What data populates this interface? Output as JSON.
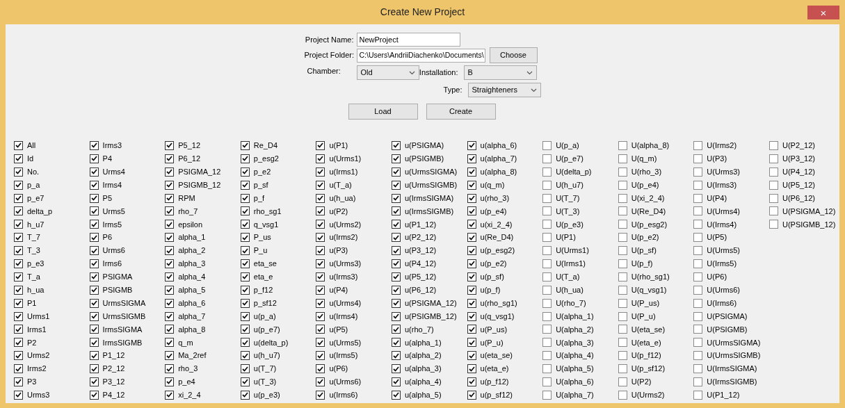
{
  "window": {
    "title": "Create New Project",
    "close": "×"
  },
  "form": {
    "project_name": {
      "label": "Project Name:",
      "value": "NewProject"
    },
    "project_folder": {
      "label": "Project Folder:",
      "value": "C:\\Users\\AndriiDiachenko\\Documents\\",
      "button": "Choose"
    },
    "chamber": {
      "label": "Chamber:",
      "value": "Old"
    },
    "installation": {
      "label": "Installation:",
      "value": "B"
    },
    "type": {
      "label": "Type:",
      "value": "Straighteners"
    },
    "buttons": [
      "Load",
      "Create"
    ]
  },
  "checkboxes": [
    {
      "label": "All",
      "checked": true
    },
    {
      "label": "Id",
      "checked": true
    },
    {
      "label": "No.",
      "checked": true
    },
    {
      "label": "p_a",
      "checked": true
    },
    {
      "label": "p_e7",
      "checked": true
    },
    {
      "label": "delta_p",
      "checked": true
    },
    {
      "label": "h_u7",
      "checked": true
    },
    {
      "label": "T_7",
      "checked": true
    },
    {
      "label": "T_3",
      "checked": true
    },
    {
      "label": "p_e3",
      "checked": true
    },
    {
      "label": "T_a",
      "checked": true
    },
    {
      "label": "h_ua",
      "checked": true
    },
    {
      "label": "P1",
      "checked": true
    },
    {
      "label": "Urms1",
      "checked": true
    },
    {
      "label": "Irms1",
      "checked": true
    },
    {
      "label": "P2",
      "checked": true
    },
    {
      "label": "Urms2",
      "checked": true
    },
    {
      "label": "Irms2",
      "checked": true
    },
    {
      "label": "P3",
      "checked": true
    },
    {
      "label": "Urms3",
      "checked": true
    },
    {
      "label": "Irms3",
      "checked": true
    },
    {
      "label": "P4",
      "checked": true
    },
    {
      "label": "Urms4",
      "checked": true
    },
    {
      "label": "Irms4",
      "checked": true
    },
    {
      "label": "P5",
      "checked": true
    },
    {
      "label": "Urms5",
      "checked": true
    },
    {
      "label": "Irms5",
      "checked": true
    },
    {
      "label": "P6",
      "checked": true
    },
    {
      "label": "Urms6",
      "checked": true
    },
    {
      "label": "Irms6",
      "checked": true
    },
    {
      "label": "PSIGMA",
      "checked": true
    },
    {
      "label": "PSIGMB",
      "checked": true
    },
    {
      "label": "UrmsSIGMA",
      "checked": true
    },
    {
      "label": "UrmsSIGMB",
      "checked": true
    },
    {
      "label": "IrmsSIGMA",
      "checked": true
    },
    {
      "label": "IrmsSIGMB",
      "checked": true
    },
    {
      "label": "P1_12",
      "checked": true
    },
    {
      "label": "P2_12",
      "checked": true
    },
    {
      "label": "P3_12",
      "checked": true
    },
    {
      "label": "P4_12",
      "checked": true
    },
    {
      "label": "P5_12",
      "checked": true
    },
    {
      "label": "P6_12",
      "checked": true
    },
    {
      "label": "PSIGMA_12",
      "checked": true
    },
    {
      "label": "PSIGMB_12",
      "checked": true
    },
    {
      "label": "RPM",
      "checked": true
    },
    {
      "label": "rho_7",
      "checked": true
    },
    {
      "label": "epsilon",
      "checked": true
    },
    {
      "label": "alpha_1",
      "checked": true
    },
    {
      "label": "alpha_2",
      "checked": true
    },
    {
      "label": "alpha_3",
      "checked": true
    },
    {
      "label": "alpha_4",
      "checked": true
    },
    {
      "label": "alpha_5",
      "checked": true
    },
    {
      "label": "alpha_6",
      "checked": true
    },
    {
      "label": "alpha_7",
      "checked": true
    },
    {
      "label": "alpha_8",
      "checked": true
    },
    {
      "label": "q_m",
      "checked": true
    },
    {
      "label": "Ma_2ref",
      "checked": true
    },
    {
      "label": "rho_3",
      "checked": true
    },
    {
      "label": "p_e4",
      "checked": true
    },
    {
      "label": "xi_2_4",
      "checked": true
    },
    {
      "label": "Re_D4",
      "checked": true
    },
    {
      "label": "p_esg2",
      "checked": true
    },
    {
      "label": "p_e2",
      "checked": true
    },
    {
      "label": "p_sf",
      "checked": true
    },
    {
      "label": "p_f",
      "checked": true
    },
    {
      "label": "rho_sg1",
      "checked": true
    },
    {
      "label": "q_vsg1",
      "checked": true
    },
    {
      "label": "P_us",
      "checked": true
    },
    {
      "label": "P_u",
      "checked": true
    },
    {
      "label": "eta_se",
      "checked": true
    },
    {
      "label": "eta_e",
      "checked": true
    },
    {
      "label": "p_f12",
      "checked": true
    },
    {
      "label": "p_sf12",
      "checked": true
    },
    {
      "label": "u(p_a)",
      "checked": true
    },
    {
      "label": "u(p_e7)",
      "checked": true
    },
    {
      "label": "u(delta_p)",
      "checked": true
    },
    {
      "label": "u(h_u7)",
      "checked": true
    },
    {
      "label": "u(T_7)",
      "checked": true
    },
    {
      "label": "u(T_3)",
      "checked": true
    },
    {
      "label": "u(p_e3)",
      "checked": true
    },
    {
      "label": "u(P1)",
      "checked": true
    },
    {
      "label": "u(Urms1)",
      "checked": true
    },
    {
      "label": "u(Irms1)",
      "checked": true
    },
    {
      "label": "u(T_a)",
      "checked": true
    },
    {
      "label": "u(h_ua)",
      "checked": true
    },
    {
      "label": "u(P2)",
      "checked": true
    },
    {
      "label": "u(Urms2)",
      "checked": true
    },
    {
      "label": "u(Irms2)",
      "checked": true
    },
    {
      "label": "u(P3)",
      "checked": true
    },
    {
      "label": "u(Urms3)",
      "checked": true
    },
    {
      "label": "u(Irms3)",
      "checked": true
    },
    {
      "label": "u(P4)",
      "checked": true
    },
    {
      "label": "u(Urms4)",
      "checked": true
    },
    {
      "label": "u(Irms4)",
      "checked": true
    },
    {
      "label": "u(P5)",
      "checked": true
    },
    {
      "label": "u(Urms5)",
      "checked": true
    },
    {
      "label": "u(Irms5)",
      "checked": true
    },
    {
      "label": "u(P6)",
      "checked": true
    },
    {
      "label": "u(Urms6)",
      "checked": true
    },
    {
      "label": "u(Irms6)",
      "checked": true
    },
    {
      "label": "u(PSIGMA)",
      "checked": true
    },
    {
      "label": "u(PSIGMB)",
      "checked": true
    },
    {
      "label": "u(UrmsSIGMA)",
      "checked": true
    },
    {
      "label": "u(UrmsSIGMB)",
      "checked": true
    },
    {
      "label": "u(IrmsSIGMA)",
      "checked": true
    },
    {
      "label": "u(IrmsSIGMB)",
      "checked": true
    },
    {
      "label": "u(P1_12)",
      "checked": true
    },
    {
      "label": "u(P2_12)",
      "checked": true
    },
    {
      "label": "u(P3_12)",
      "checked": true
    },
    {
      "label": "u(P4_12)",
      "checked": true
    },
    {
      "label": "u(P5_12)",
      "checked": true
    },
    {
      "label": "u(P6_12)",
      "checked": true
    },
    {
      "label": "u(PSIGMA_12)",
      "checked": true
    },
    {
      "label": "u(PSIGMB_12)",
      "checked": true
    },
    {
      "label": "u(rho_7)",
      "checked": true
    },
    {
      "label": "u(alpha_1)",
      "checked": true
    },
    {
      "label": "u(alpha_2)",
      "checked": true
    },
    {
      "label": "u(alpha_3)",
      "checked": true
    },
    {
      "label": "u(alpha_4)",
      "checked": true
    },
    {
      "label": "u(alpha_5)",
      "checked": true
    },
    {
      "label": "u(alpha_6)",
      "checked": true
    },
    {
      "label": "u(alpha_7)",
      "checked": true
    },
    {
      "label": "u(alpha_8)",
      "checked": true
    },
    {
      "label": "u(q_m)",
      "checked": true
    },
    {
      "label": "u(rho_3)",
      "checked": true
    },
    {
      "label": "u(p_e4)",
      "checked": true
    },
    {
      "label": "u(xi_2_4)",
      "checked": true
    },
    {
      "label": "u(Re_D4)",
      "checked": true
    },
    {
      "label": "u(p_esg2)",
      "checked": true
    },
    {
      "label": "u(p_e2)",
      "checked": true
    },
    {
      "label": "u(p_sf)",
      "checked": true
    },
    {
      "label": "u(p_f)",
      "checked": true
    },
    {
      "label": "u(rho_sg1)",
      "checked": true
    },
    {
      "label": "u(q_vsg1)",
      "checked": true
    },
    {
      "label": "u(P_us)",
      "checked": true
    },
    {
      "label": "u(P_u)",
      "checked": true
    },
    {
      "label": "u(eta_se)",
      "checked": true
    },
    {
      "label": "u(eta_e)",
      "checked": true
    },
    {
      "label": "u(p_f12)",
      "checked": true
    },
    {
      "label": "u(p_sf12)",
      "checked": true
    },
    {
      "label": "U(p_a)",
      "checked": false
    },
    {
      "label": "U(p_e7)",
      "checked": false
    },
    {
      "label": "U(delta_p)",
      "checked": false
    },
    {
      "label": "U(h_u7)",
      "checked": false
    },
    {
      "label": "U(T_7)",
      "checked": false
    },
    {
      "label": "U(T_3)",
      "checked": false
    },
    {
      "label": "U(p_e3)",
      "checked": false
    },
    {
      "label": "U(P1)",
      "checked": false
    },
    {
      "label": "U(Urms1)",
      "checked": false
    },
    {
      "label": "U(Irms1)",
      "checked": false
    },
    {
      "label": "U(T_a)",
      "checked": false
    },
    {
      "label": "U(h_ua)",
      "checked": false
    },
    {
      "label": "U(rho_7)",
      "checked": false
    },
    {
      "label": "U(alpha_1)",
      "checked": false
    },
    {
      "label": "U(alpha_2)",
      "checked": false
    },
    {
      "label": "U(alpha_3)",
      "checked": false
    },
    {
      "label": "U(alpha_4)",
      "checked": false
    },
    {
      "label": "U(alpha_5)",
      "checked": false
    },
    {
      "label": "U(alpha_6)",
      "checked": false
    },
    {
      "label": "U(alpha_7)",
      "checked": false
    },
    {
      "label": "U(alpha_8)",
      "checked": false
    },
    {
      "label": "U(q_m)",
      "checked": false
    },
    {
      "label": "U(rho_3)",
      "checked": false
    },
    {
      "label": "U(p_e4)",
      "checked": false
    },
    {
      "label": "U(xi_2_4)",
      "checked": false
    },
    {
      "label": "U(Re_D4)",
      "checked": false
    },
    {
      "label": "U(p_esg2)",
      "checked": false
    },
    {
      "label": "U(p_e2)",
      "checked": false
    },
    {
      "label": "U(p_sf)",
      "checked": false
    },
    {
      "label": "U(p_f)",
      "checked": false
    },
    {
      "label": "U(rho_sg1)",
      "checked": false
    },
    {
      "label": "U(q_vsg1)",
      "checked": false
    },
    {
      "label": "U(P_us)",
      "checked": false
    },
    {
      "label": "U(P_u)",
      "checked": false
    },
    {
      "label": "U(eta_se)",
      "checked": false
    },
    {
      "label": "U(eta_e)",
      "checked": false
    },
    {
      "label": "U(p_f12)",
      "checked": false
    },
    {
      "label": "U(p_sf12)",
      "checked": false
    },
    {
      "label": "U(P2)",
      "checked": false
    },
    {
      "label": "U(Urms2)",
      "checked": false
    },
    {
      "label": "U(Irms2)",
      "checked": false
    },
    {
      "label": "U(P3)",
      "checked": false
    },
    {
      "label": "U(Urms3)",
      "checked": false
    },
    {
      "label": "U(Irms3)",
      "checked": false
    },
    {
      "label": "U(P4)",
      "checked": false
    },
    {
      "label": "U(Urms4)",
      "checked": false
    },
    {
      "label": "U(Irms4)",
      "checked": false
    },
    {
      "label": "U(P5)",
      "checked": false
    },
    {
      "label": "U(Urms5)",
      "checked": false
    },
    {
      "label": "U(Irms5)",
      "checked": false
    },
    {
      "label": "U(P6)",
      "checked": false
    },
    {
      "label": "U(Urms6)",
      "checked": false
    },
    {
      "label": "U(Irms6)",
      "checked": false
    },
    {
      "label": "U(PSIGMA)",
      "checked": false
    },
    {
      "label": "U(PSIGMB)",
      "checked": false
    },
    {
      "label": "U(UrmsSIGMA)",
      "checked": false
    },
    {
      "label": "U(UrmsSIGMB)",
      "checked": false
    },
    {
      "label": "U(IrmsSIGMA)",
      "checked": false
    },
    {
      "label": "U(IrmsSIGMB)",
      "checked": false
    },
    {
      "label": "U(P1_12)",
      "checked": false
    },
    {
      "label": "U(P2_12)",
      "checked": false
    },
    {
      "label": "U(P3_12)",
      "checked": false
    },
    {
      "label": "U(P4_12)",
      "checked": false
    },
    {
      "label": "U(P5_12)",
      "checked": false
    },
    {
      "label": "U(P6_12)",
      "checked": false
    },
    {
      "label": "U(PSIGMA_12)",
      "checked": false
    },
    {
      "label": "U(PSIGMB_12)",
      "checked": false
    }
  ]
}
